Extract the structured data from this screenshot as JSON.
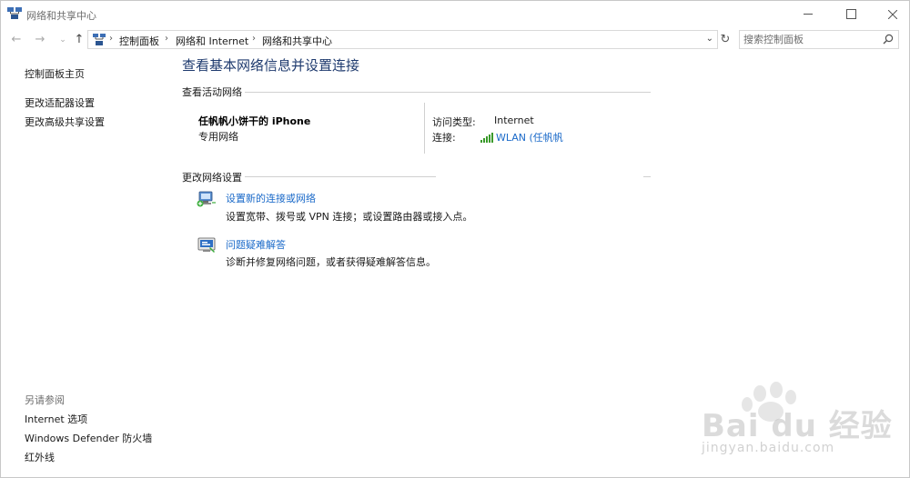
{
  "window": {
    "title": "网络和共享中心"
  },
  "nav": {
    "back": "←",
    "forward": "→",
    "history": "⌄",
    "up": "↑",
    "refresh": "↻",
    "address_dropdown": "⌄"
  },
  "breadcrumb": {
    "items": [
      "控制面板",
      "网络和 Internet",
      "网络和共享中心"
    ],
    "separator": "›"
  },
  "search": {
    "placeholder": "搜索控制面板"
  },
  "sidebar": {
    "home": "控制面板主页",
    "links": [
      "更改适配器设置",
      "更改高级共享设置"
    ],
    "see_also_heading": "另请参阅",
    "see_also": [
      "Internet 选项",
      "Windows Defender 防火墙",
      "红外线"
    ]
  },
  "main": {
    "title": "查看基本网络信息并设置连接",
    "active_networks_heading": "查看活动网络",
    "network": {
      "name": "任帆帆小饼干的 iPhone",
      "type": "专用网络",
      "access_type_label": "访问类型:",
      "access_type_value": "Internet",
      "connection_label": "连接:",
      "connection_value": "WLAN (任帆帆"
    },
    "change_settings_heading": "更改网络设置",
    "tasks": [
      {
        "link": "设置新的连接或网络",
        "description": "设置宽带、拨号或 VPN 连接；或设置路由器或接入点。"
      },
      {
        "link": "问题疑难解答",
        "description": "诊断并修复网络问题，或者获得疑难解答信息。"
      }
    ]
  },
  "watermark": {
    "brand": "Bai du 经验",
    "url": "jingyan.baidu.com"
  },
  "colors": {
    "link": "#1b6ac9",
    "title": "#1e3a6e",
    "signal": "#3a9a2a"
  }
}
